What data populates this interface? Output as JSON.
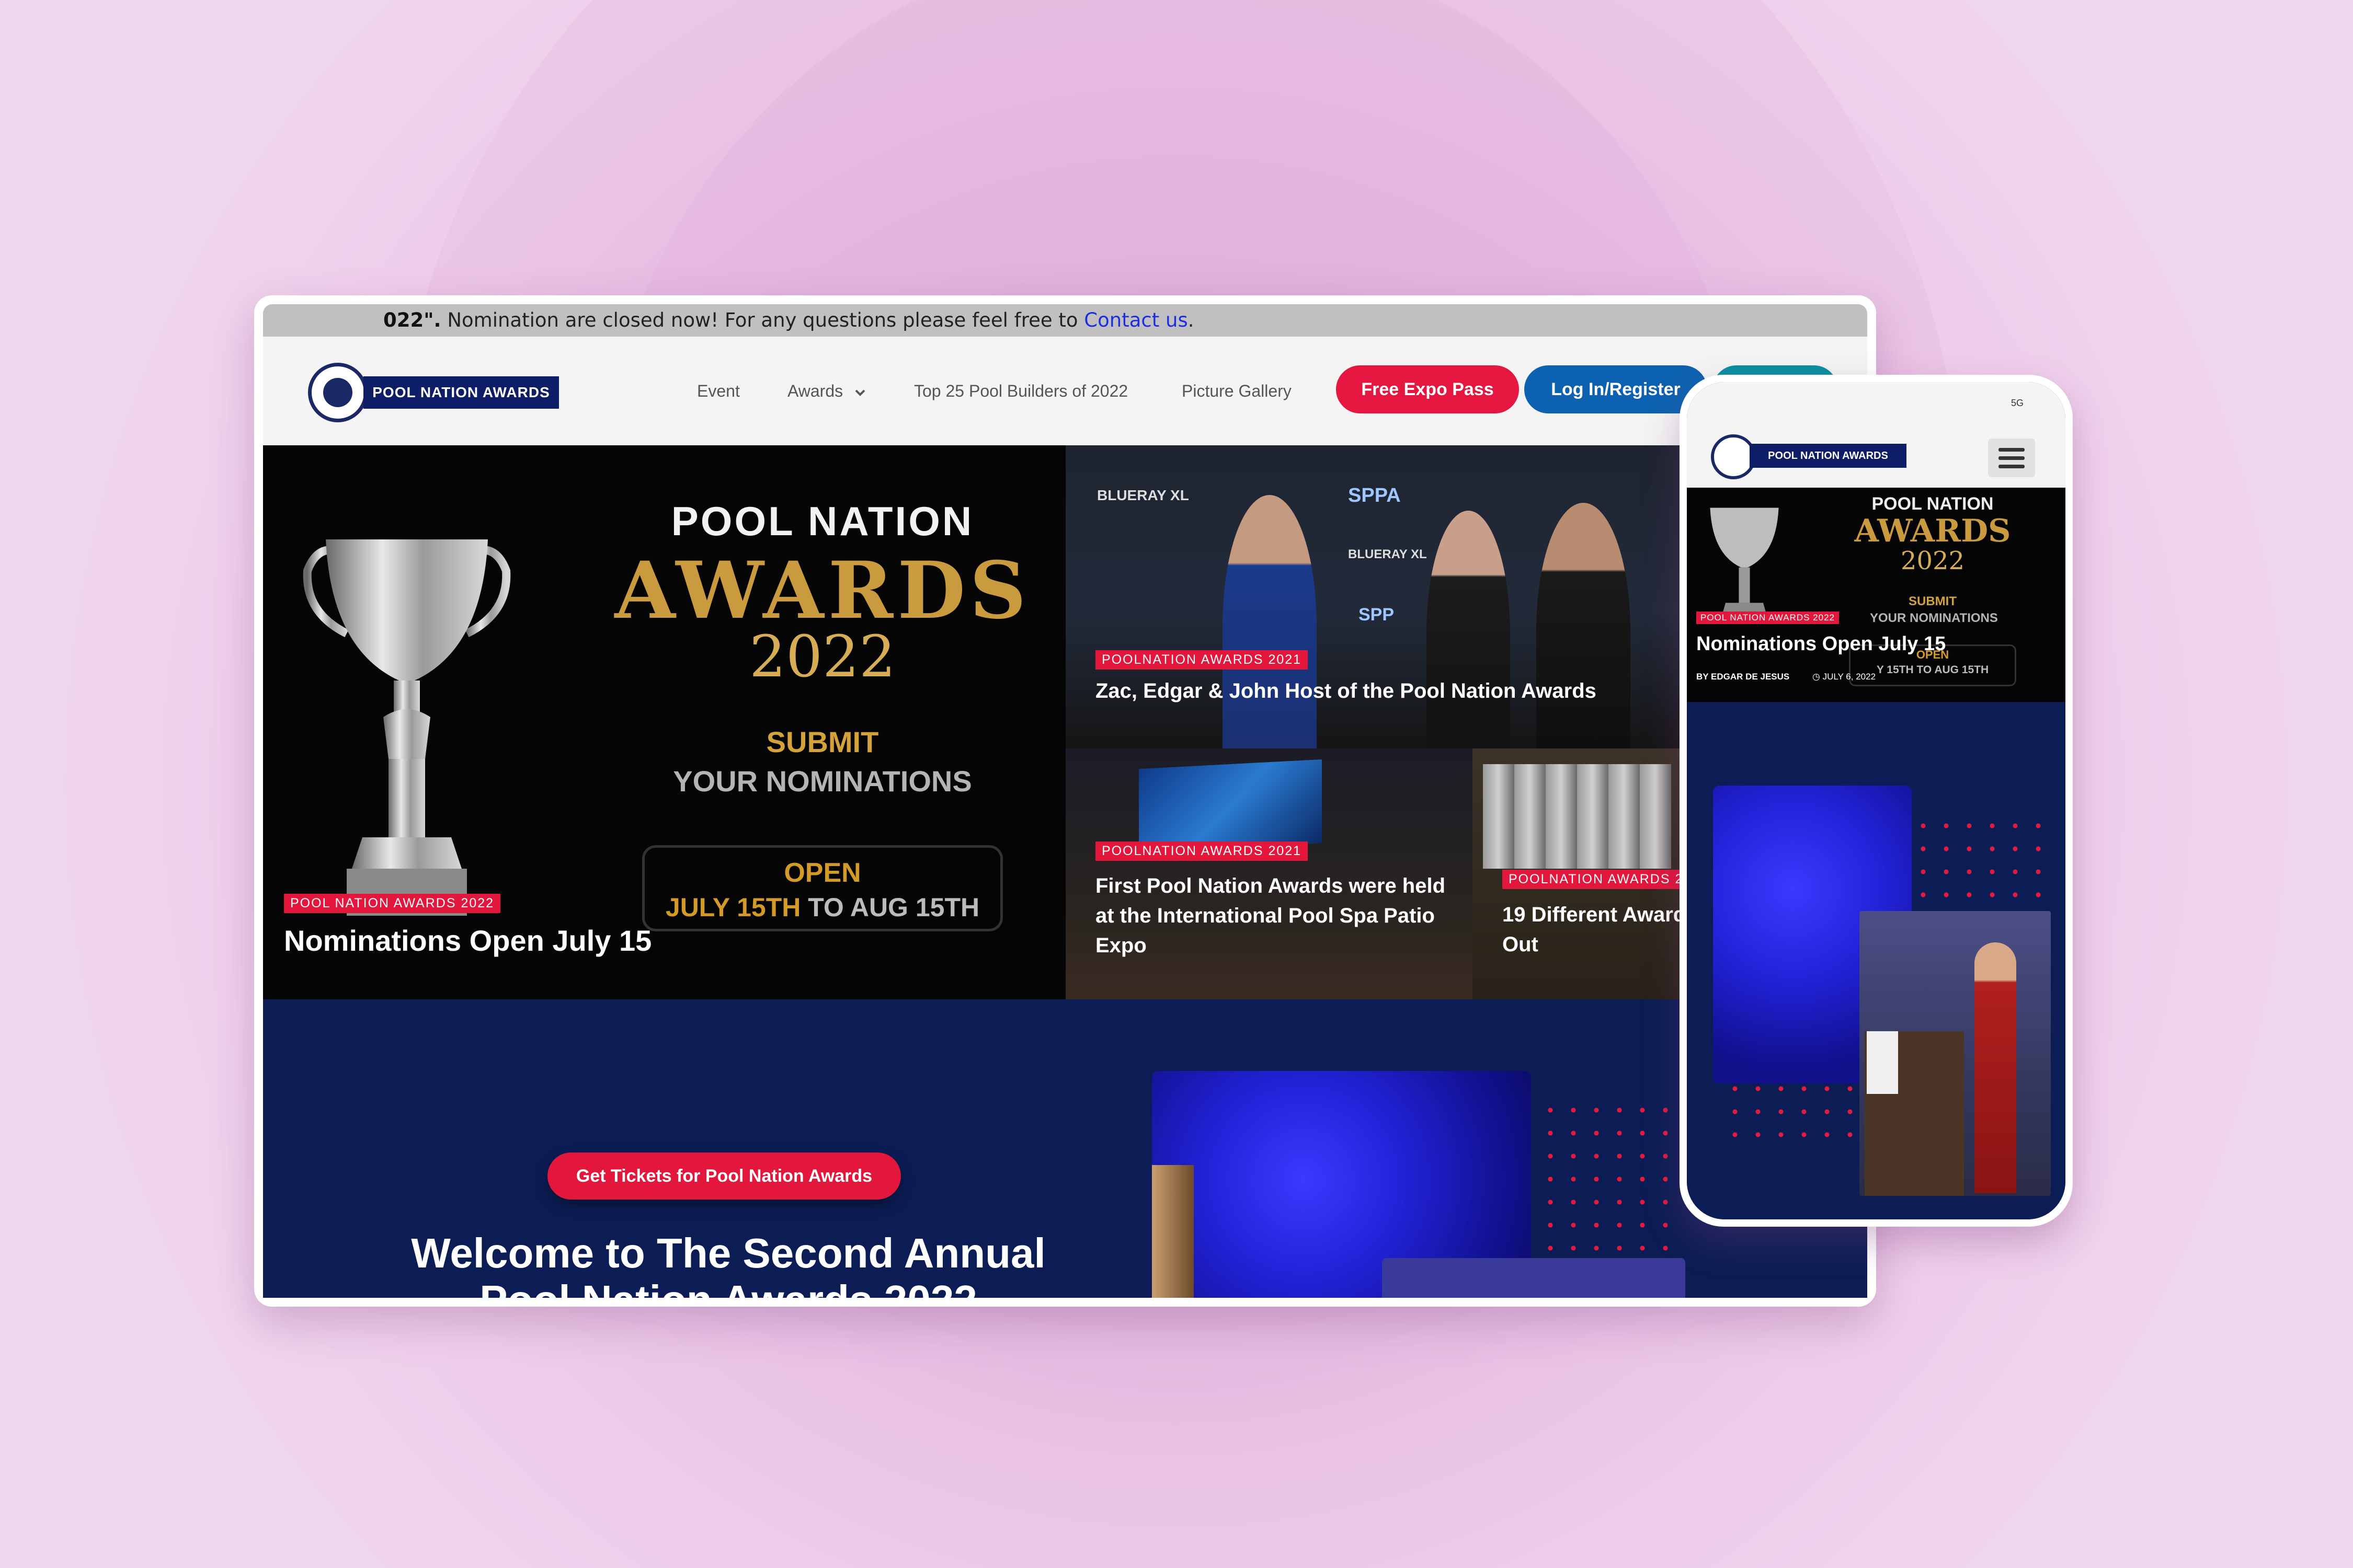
{
  "notice": {
    "prefix": "022\".",
    "text": " Nomination are closed now! For any questions please feel free to ",
    "link": "Contact us",
    "suffix": "."
  },
  "brand": {
    "name": "POOL NATION AWARDS"
  },
  "nav": {
    "items": [
      "Event",
      "Awards",
      "Top 25 Pool Builders of 2022",
      "Picture Gallery"
    ],
    "buttons": {
      "expo": "Free Expo Pass",
      "login": "Log In/Register"
    }
  },
  "featured": {
    "graphic": {
      "brand": "POOL NATION",
      "awards": "AWARDS",
      "year": "2022",
      "submit": "SUBMIT",
      "your": "YOUR NOMINATIONS",
      "open": "OPEN",
      "dates_gold": "JULY 15TH",
      "dates_rest": " TO AUG 15TH"
    },
    "tag": "POOL NATION AWARDS 2022",
    "title": "Nominations Open July 15"
  },
  "tiles": [
    {
      "tag": "POOLNATION AWARDS 2021",
      "title": "Zac, Edgar & John Host of the Pool Nation Awards"
    },
    {
      "tag": "POOLNATION AWARDS 2021",
      "title": "First Pool Nation Awards were held at the International Pool Spa Patio Expo"
    },
    {
      "tag": "POOLNATION AWARDS 2",
      "title": "19 Different Award Out"
    }
  ],
  "sponsors": [
    "BLUERAY XL",
    "SPPA",
    "BLUERAY XL",
    "SPP"
  ],
  "band": {
    "tickets": "Get Tickets for Pool Nation Awards",
    "welcome_line1": "Welcome to The Second Annual",
    "welcome_line2": "Pool Nation Awards 2022"
  },
  "phone": {
    "status": "5G",
    "featured": {
      "brand": "POOL NATION",
      "awards": "AWARDS",
      "year": "2022",
      "submit": "SUBMIT",
      "your": "YOUR NOMINATIONS",
      "open": "OPEN",
      "dates": "Y 15TH TO AUG 15TH",
      "tag": "POOL NATION AWARDS 2022",
      "title": "Nominations Open July 15",
      "author": "BY EDGAR DE JESUS",
      "date": "JULY 6, 2022"
    }
  },
  "colors": {
    "accent_red": "#e3163b",
    "navy": "#0c1d55",
    "blue_button": "#0c62b0",
    "gold": "#c99a3e"
  }
}
